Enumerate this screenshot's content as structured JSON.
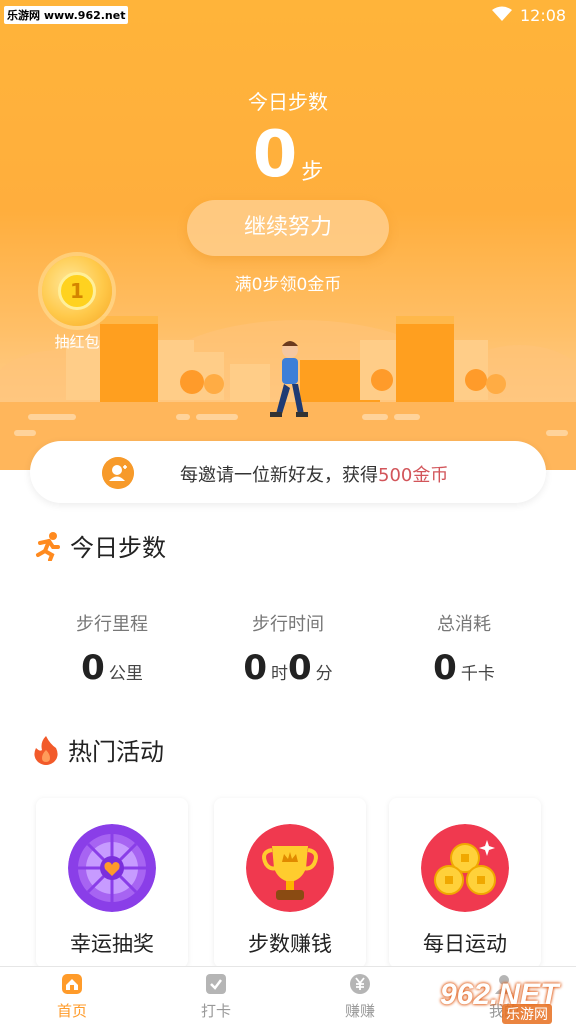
{
  "statusbar": {
    "watermark": "乐游网 www.962.net",
    "time": "12:08"
  },
  "hero": {
    "title": "今日步数",
    "steps": "0",
    "steps_unit": "步",
    "continue_label": "继续努力",
    "goal_text": "满0步领0金币",
    "redpacket_coin": "1",
    "redpacket_label": "抽红包"
  },
  "invite": {
    "text": "每邀请一位新好友，获得",
    "reward": "500金币"
  },
  "today": {
    "title": "今日步数",
    "stats": [
      {
        "label": "步行里程",
        "value": "0",
        "unit": "公里"
      },
      {
        "label": "步行时间",
        "hours": "0",
        "hours_unit": "时",
        "minutes": "0",
        "minutes_unit": "分"
      },
      {
        "label": "总消耗",
        "value": "0",
        "unit": "千卡"
      }
    ]
  },
  "activities": {
    "title": "热门活动",
    "cards": [
      {
        "label": "幸运抽奖",
        "icon": "lucky-wheel-icon"
      },
      {
        "label": "步数赚钱",
        "icon": "trophy-icon"
      },
      {
        "label": "每日运动",
        "icon": "gold-coins-icon"
      }
    ]
  },
  "tabbar": {
    "tabs": [
      {
        "label": "首页",
        "active": true
      },
      {
        "label": "打卡",
        "active": false
      },
      {
        "label": "赚赚",
        "active": false
      },
      {
        "label": "我的",
        "active": false
      }
    ]
  },
  "watermark_bottom": {
    "logo": "962.NET",
    "text": "乐游网"
  },
  "colors": {
    "accent": "#ff9b2a",
    "reward": "#d2555a",
    "hero_top": "#ffb43a"
  }
}
